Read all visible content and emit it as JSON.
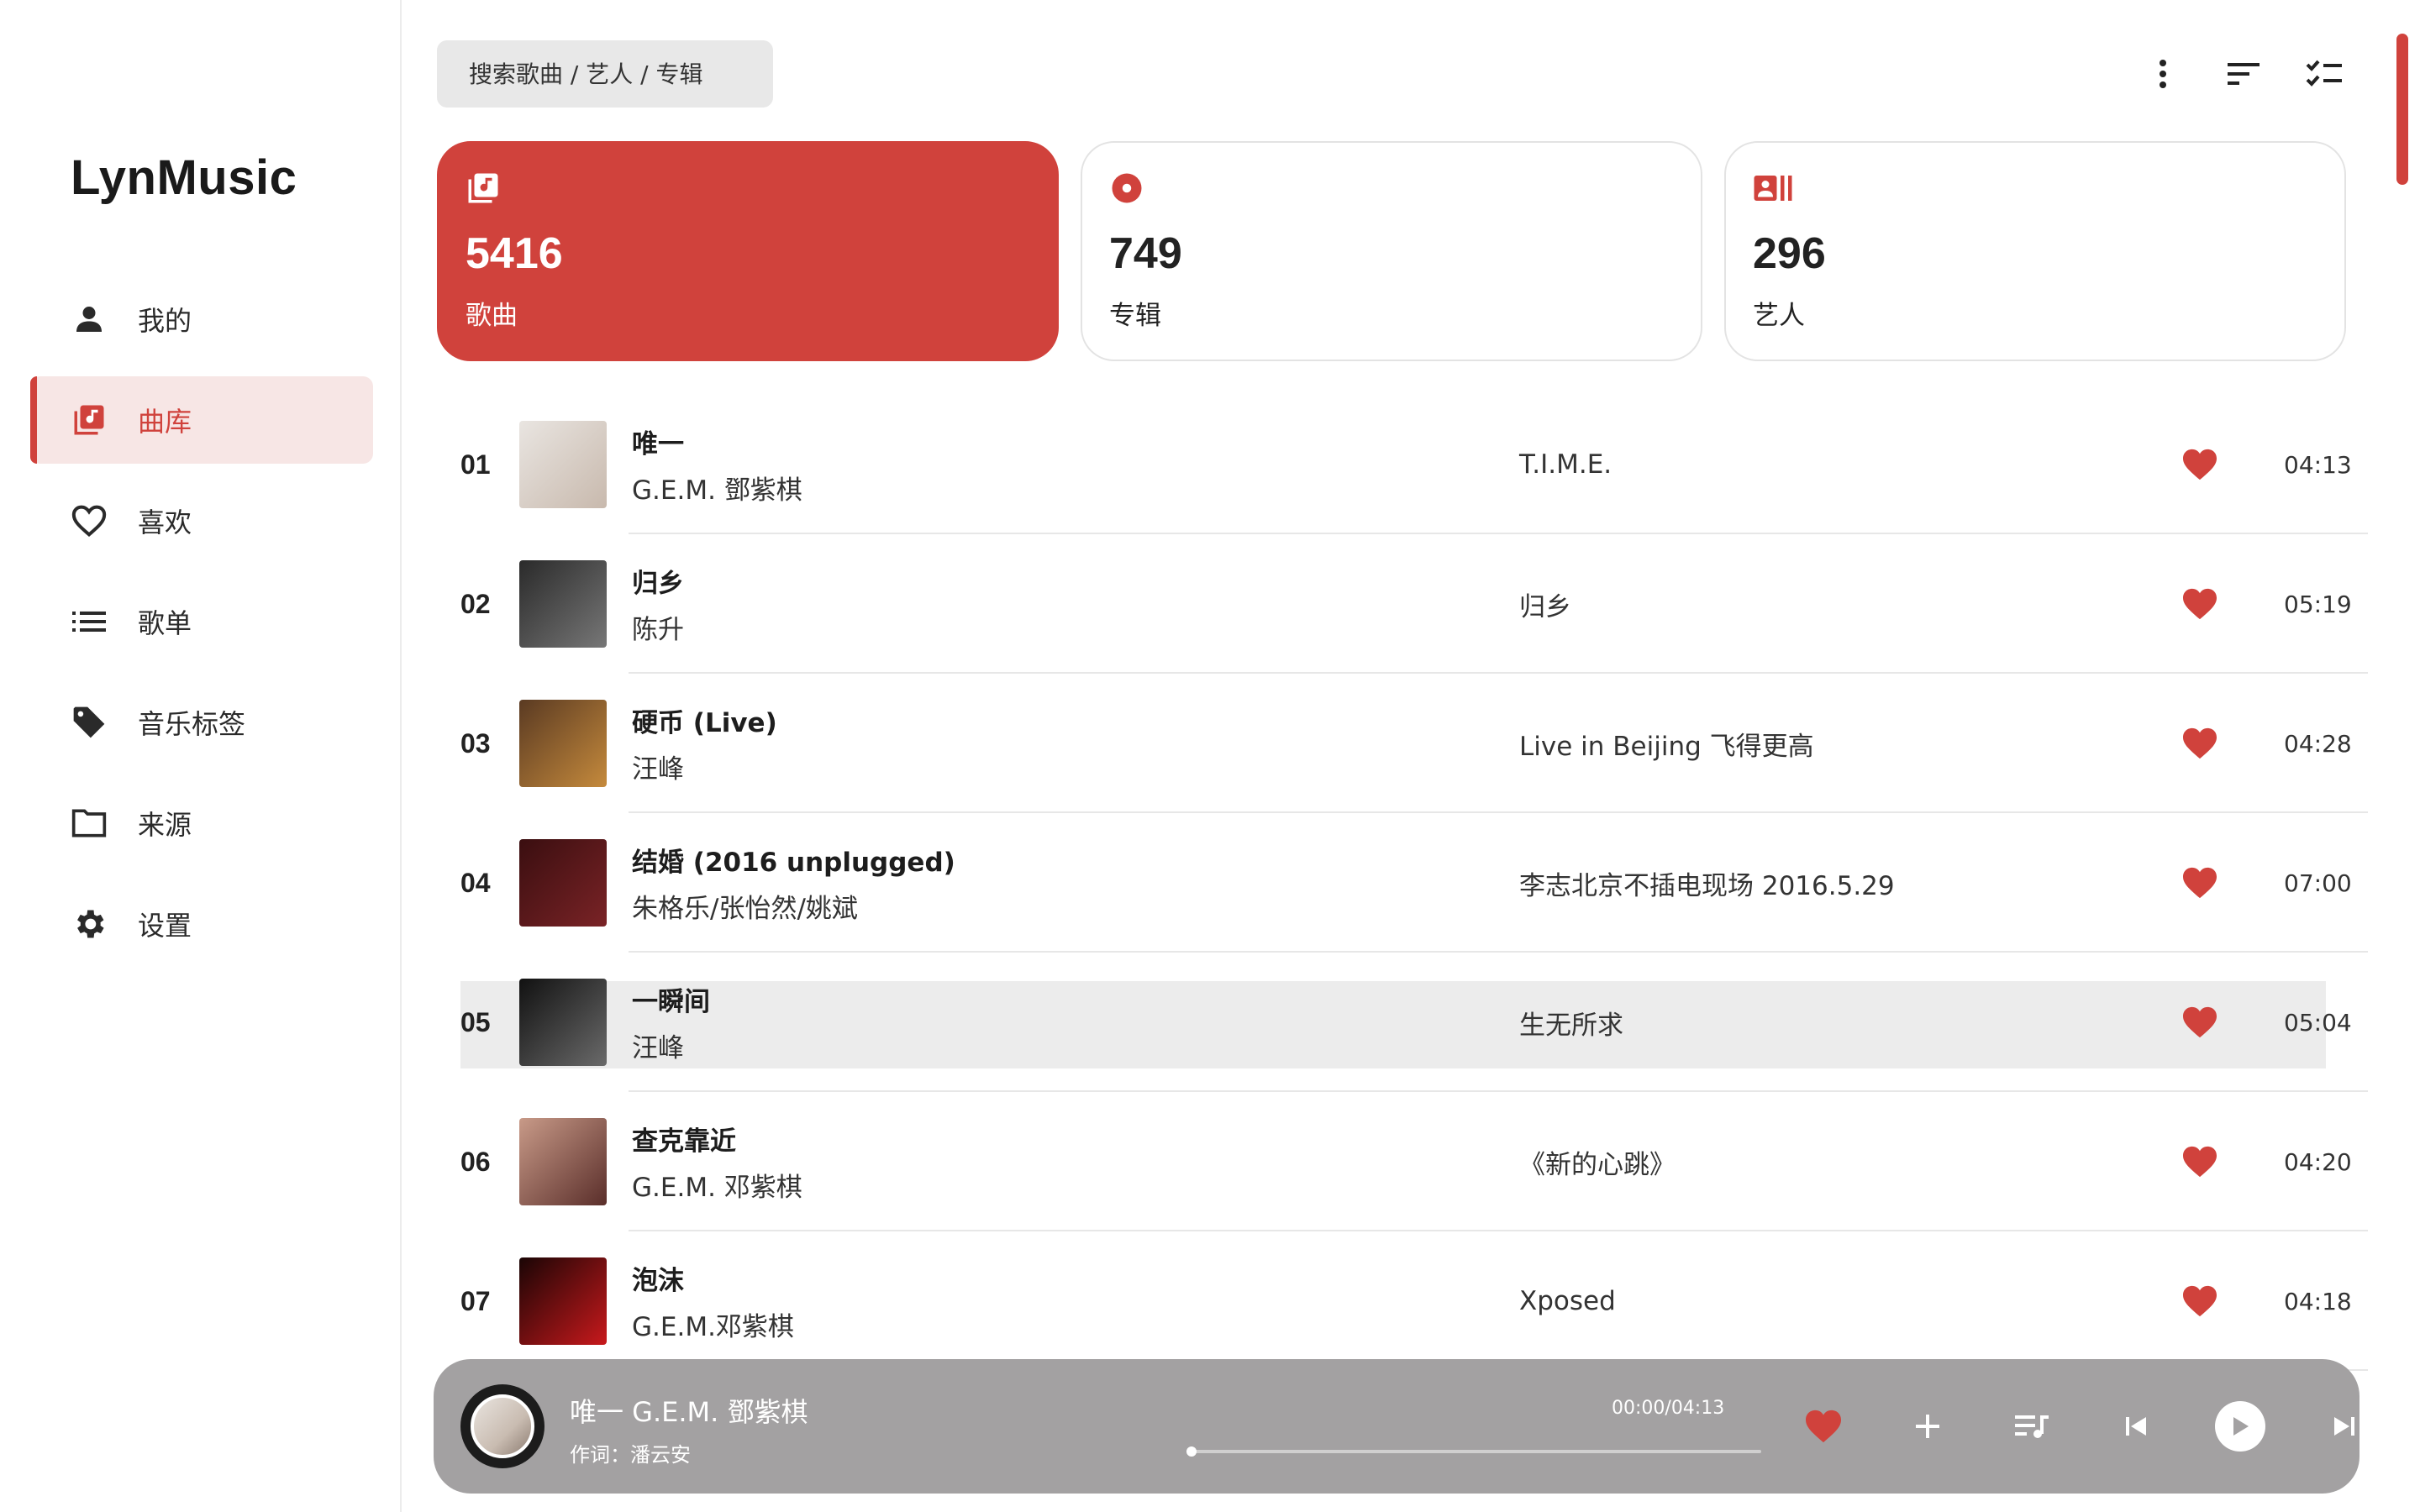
{
  "app": {
    "name": "LynMusic"
  },
  "sidebar": {
    "items": [
      {
        "label": "我的",
        "icon": "person-icon",
        "active": false
      },
      {
        "label": "曲库",
        "icon": "library-music-icon",
        "active": true
      },
      {
        "label": "喜欢",
        "icon": "heart-outline-icon",
        "active": false
      },
      {
        "label": "歌单",
        "icon": "list-icon",
        "active": false
      },
      {
        "label": "音乐标签",
        "icon": "tag-icon",
        "active": false
      },
      {
        "label": "来源",
        "icon": "folder-icon",
        "active": false
      },
      {
        "label": "设置",
        "icon": "gear-icon",
        "active": false
      }
    ]
  },
  "search": {
    "placeholder": "搜索歌曲 / 艺人 / 专辑"
  },
  "stats": [
    {
      "count": "5416",
      "label": "歌曲",
      "icon": "library-music-icon",
      "active": true
    },
    {
      "count": "749",
      "label": "专辑",
      "icon": "album-icon",
      "active": false
    },
    {
      "count": "296",
      "label": "艺人",
      "icon": "artist-card-icon",
      "active": false
    }
  ],
  "tracks": [
    {
      "num": "01",
      "title": "唯一",
      "artist": "G.E.M. 鄧紫棋",
      "album": "T.I.M.E.",
      "duration": "04:13",
      "liked": true,
      "cover": [
        "#e9e5e1",
        "#c8b9ad"
      ]
    },
    {
      "num": "02",
      "title": "归乡",
      "artist": "陈升",
      "album": "归乡",
      "duration": "05:19",
      "liked": true,
      "cover": [
        "#2a2a2a",
        "#777777"
      ]
    },
    {
      "num": "03",
      "title": "硬币 (Live)",
      "artist": "汪峰",
      "album": "Live in Beijing 飞得更高",
      "duration": "04:28",
      "liked": true,
      "cover": [
        "#5a3a22",
        "#c58a3c"
      ]
    },
    {
      "num": "04",
      "title": "结婚 (2016 unplugged)",
      "artist": "朱格乐/张怡然/姚斌",
      "album": "李志北京不插电现场 2016.5.29",
      "duration": "07:00",
      "liked": true,
      "cover": [
        "#3a0e10",
        "#7a2326"
      ]
    },
    {
      "num": "05",
      "title": "一瞬间",
      "artist": "汪峰",
      "album": "生无所求",
      "duration": "05:04",
      "liked": true,
      "cover": [
        "#111111",
        "#6a6a6a"
      ]
    },
    {
      "num": "06",
      "title": "查克靠近",
      "artist": "G.E.M. 邓紫棋",
      "album": "《新的心跳》",
      "duration": "04:20",
      "liked": true,
      "cover": [
        "#c89a88",
        "#5a2e2a"
      ]
    },
    {
      "num": "07",
      "title": "泡沫",
      "artist": "G.E.M.邓紫棋",
      "album": "Xposed",
      "duration": "04:18",
      "liked": true,
      "cover": [
        "#1a0505",
        "#c8191c"
      ]
    }
  ],
  "hover_track_index": 4,
  "player": {
    "title": "唯一  G.E.M. 鄧紫棋",
    "subtitle": "作词：潘云安",
    "time": "00:00/04:13",
    "progress": 0.0
  },
  "colors": {
    "accent": "#d0423c",
    "accent_light": "#f7e6e5",
    "player_bg": "#a3a1a2"
  }
}
